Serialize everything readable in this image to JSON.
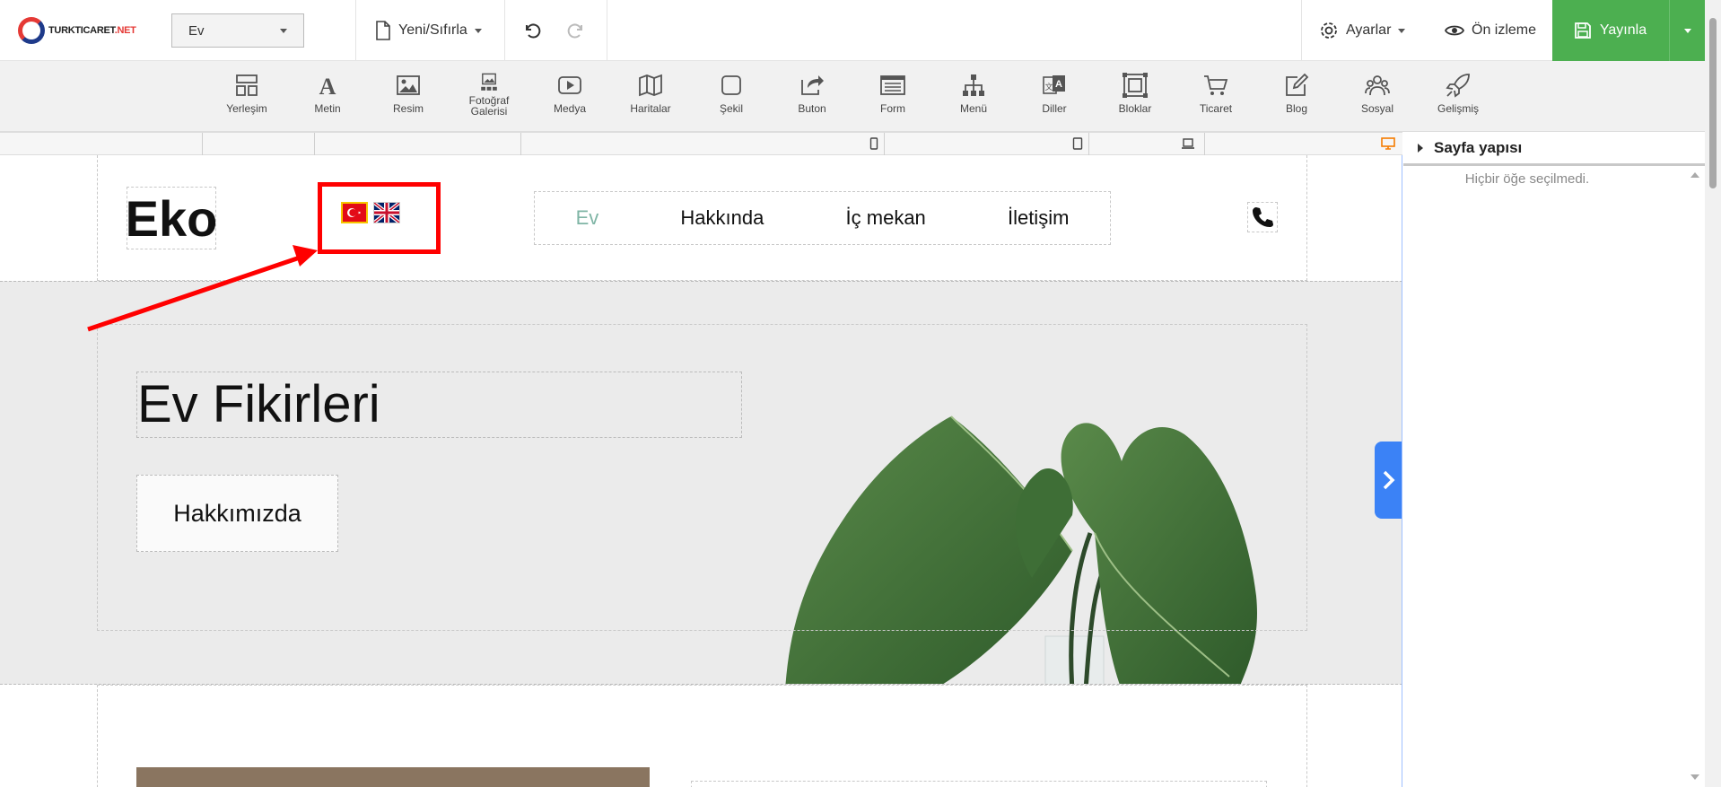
{
  "topbar": {
    "logo_main": "TURKTICARET",
    "logo_suffix": ".NET",
    "page_select": "Ev",
    "new_reset": "Yeni/Sıfırla",
    "settings": "Ayarlar",
    "preview": "Ön izleme",
    "publish": "Yayınla"
  },
  "toolbar": {
    "items": [
      {
        "label": "Yerleşim",
        "icon": "layout-icon"
      },
      {
        "label": "Metin",
        "icon": "text-icon"
      },
      {
        "label": "Resim",
        "icon": "image-icon"
      },
      {
        "label": "Fotoğraf Galerisi",
        "icon": "gallery-icon"
      },
      {
        "label": "Medya",
        "icon": "video-icon"
      },
      {
        "label": "Haritalar",
        "icon": "map-icon"
      },
      {
        "label": "Şekil",
        "icon": "shape-icon"
      },
      {
        "label": "Buton",
        "icon": "button-icon"
      },
      {
        "label": "Form",
        "icon": "form-icon"
      },
      {
        "label": "Menü",
        "icon": "menu-icon"
      },
      {
        "label": "Diller",
        "icon": "languages-icon"
      },
      {
        "label": "Bloklar",
        "icon": "blocks-icon"
      },
      {
        "label": "Ticaret",
        "icon": "cart-icon"
      },
      {
        "label": "Blog",
        "icon": "blog-icon"
      },
      {
        "label": "Sosyal",
        "icon": "social-icon"
      },
      {
        "label": "Gelişmiş",
        "icon": "rocket-icon"
      }
    ]
  },
  "site": {
    "logo": "Eko",
    "nav": [
      "Ev",
      "Hakkında",
      "İç mekan",
      "İletişim"
    ],
    "hero_title": "Ev Fikirleri",
    "hero_button": "Hakkımızda"
  },
  "panel": {
    "title": "Sayfa yapısı",
    "empty": "Hiçbir öğe seçilmedi."
  },
  "colors": {
    "publish": "#4caf50",
    "highlight": "#ff0000",
    "nav_active": "#7fb5a5",
    "toggle": "#3b82f6"
  }
}
